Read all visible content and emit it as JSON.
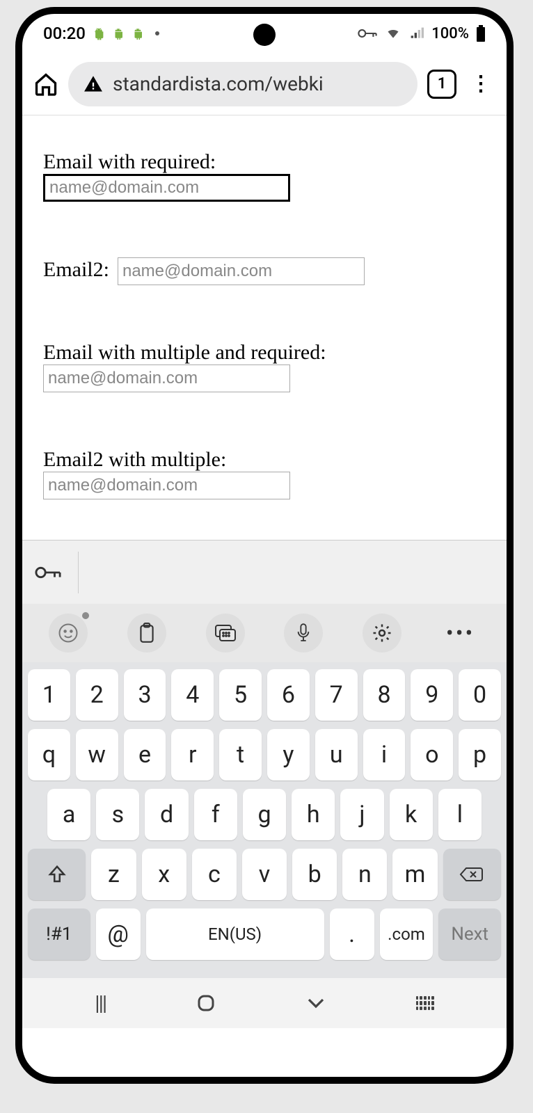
{
  "status": {
    "time": "00:20",
    "battery_text": "100%"
  },
  "browser": {
    "url_display": "standardista.com/webki",
    "tab_count": "1"
  },
  "form": {
    "fields": [
      {
        "label": "Email with required:",
        "placeholder": "name@domain.com",
        "focused": true,
        "inline": false
      },
      {
        "label": "Email2:",
        "placeholder": "name@domain.com",
        "focused": false,
        "inline": true
      },
      {
        "label": "Email with multiple and required:",
        "placeholder": "name@domain.com",
        "focused": false,
        "inline": false
      },
      {
        "label": "Email2 with multiple:",
        "placeholder": "name@domain.com",
        "focused": false,
        "inline": false
      }
    ]
  },
  "keyboard": {
    "row_num": [
      "1",
      "2",
      "3",
      "4",
      "5",
      "6",
      "7",
      "8",
      "9",
      "0"
    ],
    "row1": [
      "q",
      "w",
      "e",
      "r",
      "t",
      "y",
      "u",
      "i",
      "o",
      "p"
    ],
    "row2": [
      "a",
      "s",
      "d",
      "f",
      "g",
      "h",
      "j",
      "k",
      "l"
    ],
    "row3": [
      "z",
      "x",
      "c",
      "v",
      "b",
      "n",
      "m"
    ],
    "shift": "⇧",
    "backspace": "⌫",
    "sym_key": "!#1",
    "at_key": "@",
    "lang_key": "EN(US)",
    "period_key": ".",
    "com_key": ".com",
    "next_key": "Next"
  }
}
